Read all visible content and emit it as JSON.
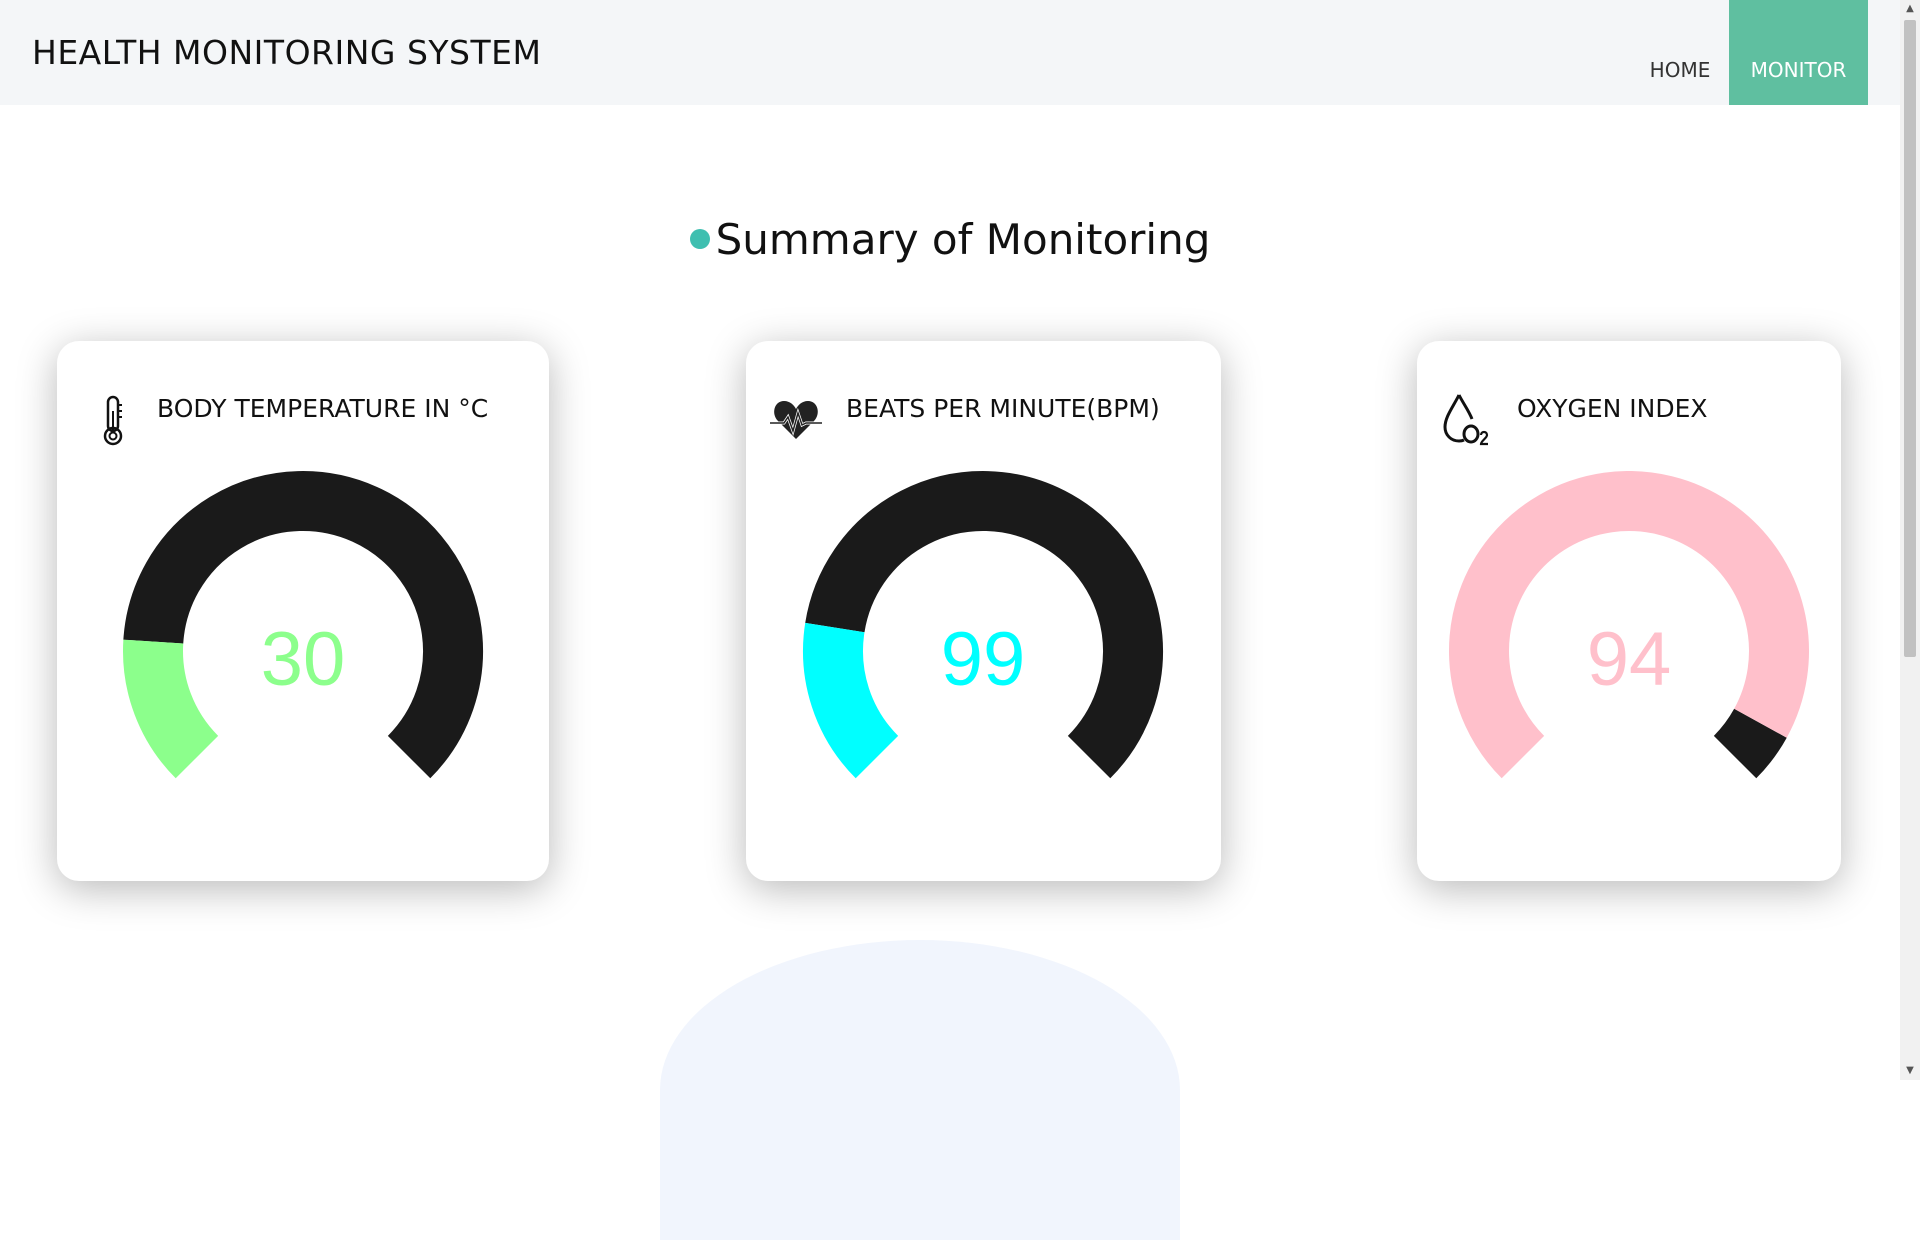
{
  "navbar": {
    "brand": "HEALTH MONITORING SYSTEM",
    "links": [
      {
        "label": "HOME",
        "active": false
      },
      {
        "label": "MONITOR",
        "active": true
      }
    ]
  },
  "section_title": "Summary of Monitoring",
  "cards": [
    {
      "title": "BODY TEMPERATURE IN °C",
      "icon": "thermometer-icon",
      "value": "30",
      "fraction": 0.18,
      "color": "#8cff8c",
      "track_color": "#1a1a1a"
    },
    {
      "title": "BEATS PER MINUTE(BPM)",
      "icon": "heart-pulse-icon",
      "value": "99",
      "fraction": 0.2,
      "color": "#00ffff",
      "track_color": "#1a1a1a"
    },
    {
      "title": "OXYGEN INDEX",
      "icon": "oxygen-drop-icon",
      "value": "94",
      "fraction": 0.94,
      "color": "#ffc0cb",
      "track_color": "#1a1a1a"
    }
  ]
}
